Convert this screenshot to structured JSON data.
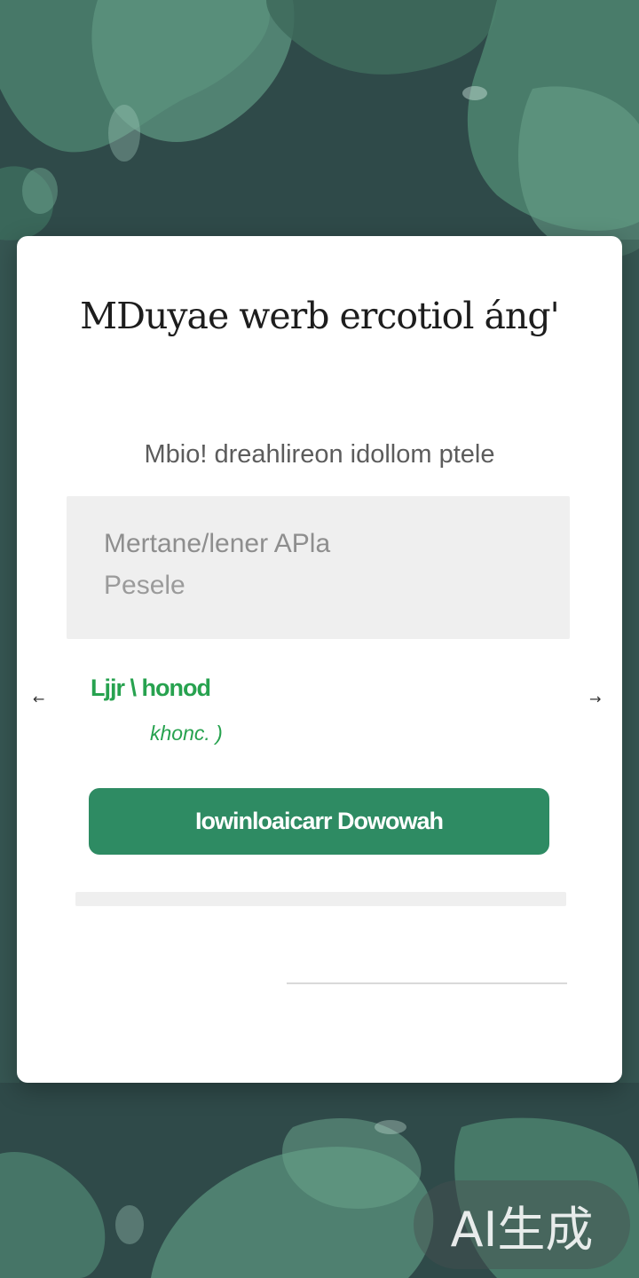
{
  "colors": {
    "background": "#2f4a49",
    "card": "#ffffff",
    "accent_green": "#27a24f",
    "button_green": "#2e8b63",
    "field_gray": "#efefef"
  },
  "card": {
    "title": "MDuyae werb ercotiol áng'",
    "subtitle": "Mbio! dreahlireon idollom ptele",
    "field": {
      "line1": "Mertane/lener APla",
      "line2": "Pesele"
    },
    "left_arrow": "←",
    "right_arrow": "→",
    "link_primary": "Ljjr \\ honod",
    "link_secondary": "khonc. )",
    "download_button": "Iowinloaicarr Dowowah"
  },
  "watermark": {
    "text": "AI生成"
  },
  "icons": {
    "left": "arrow-left-icon",
    "right": "arrow-right-icon"
  }
}
